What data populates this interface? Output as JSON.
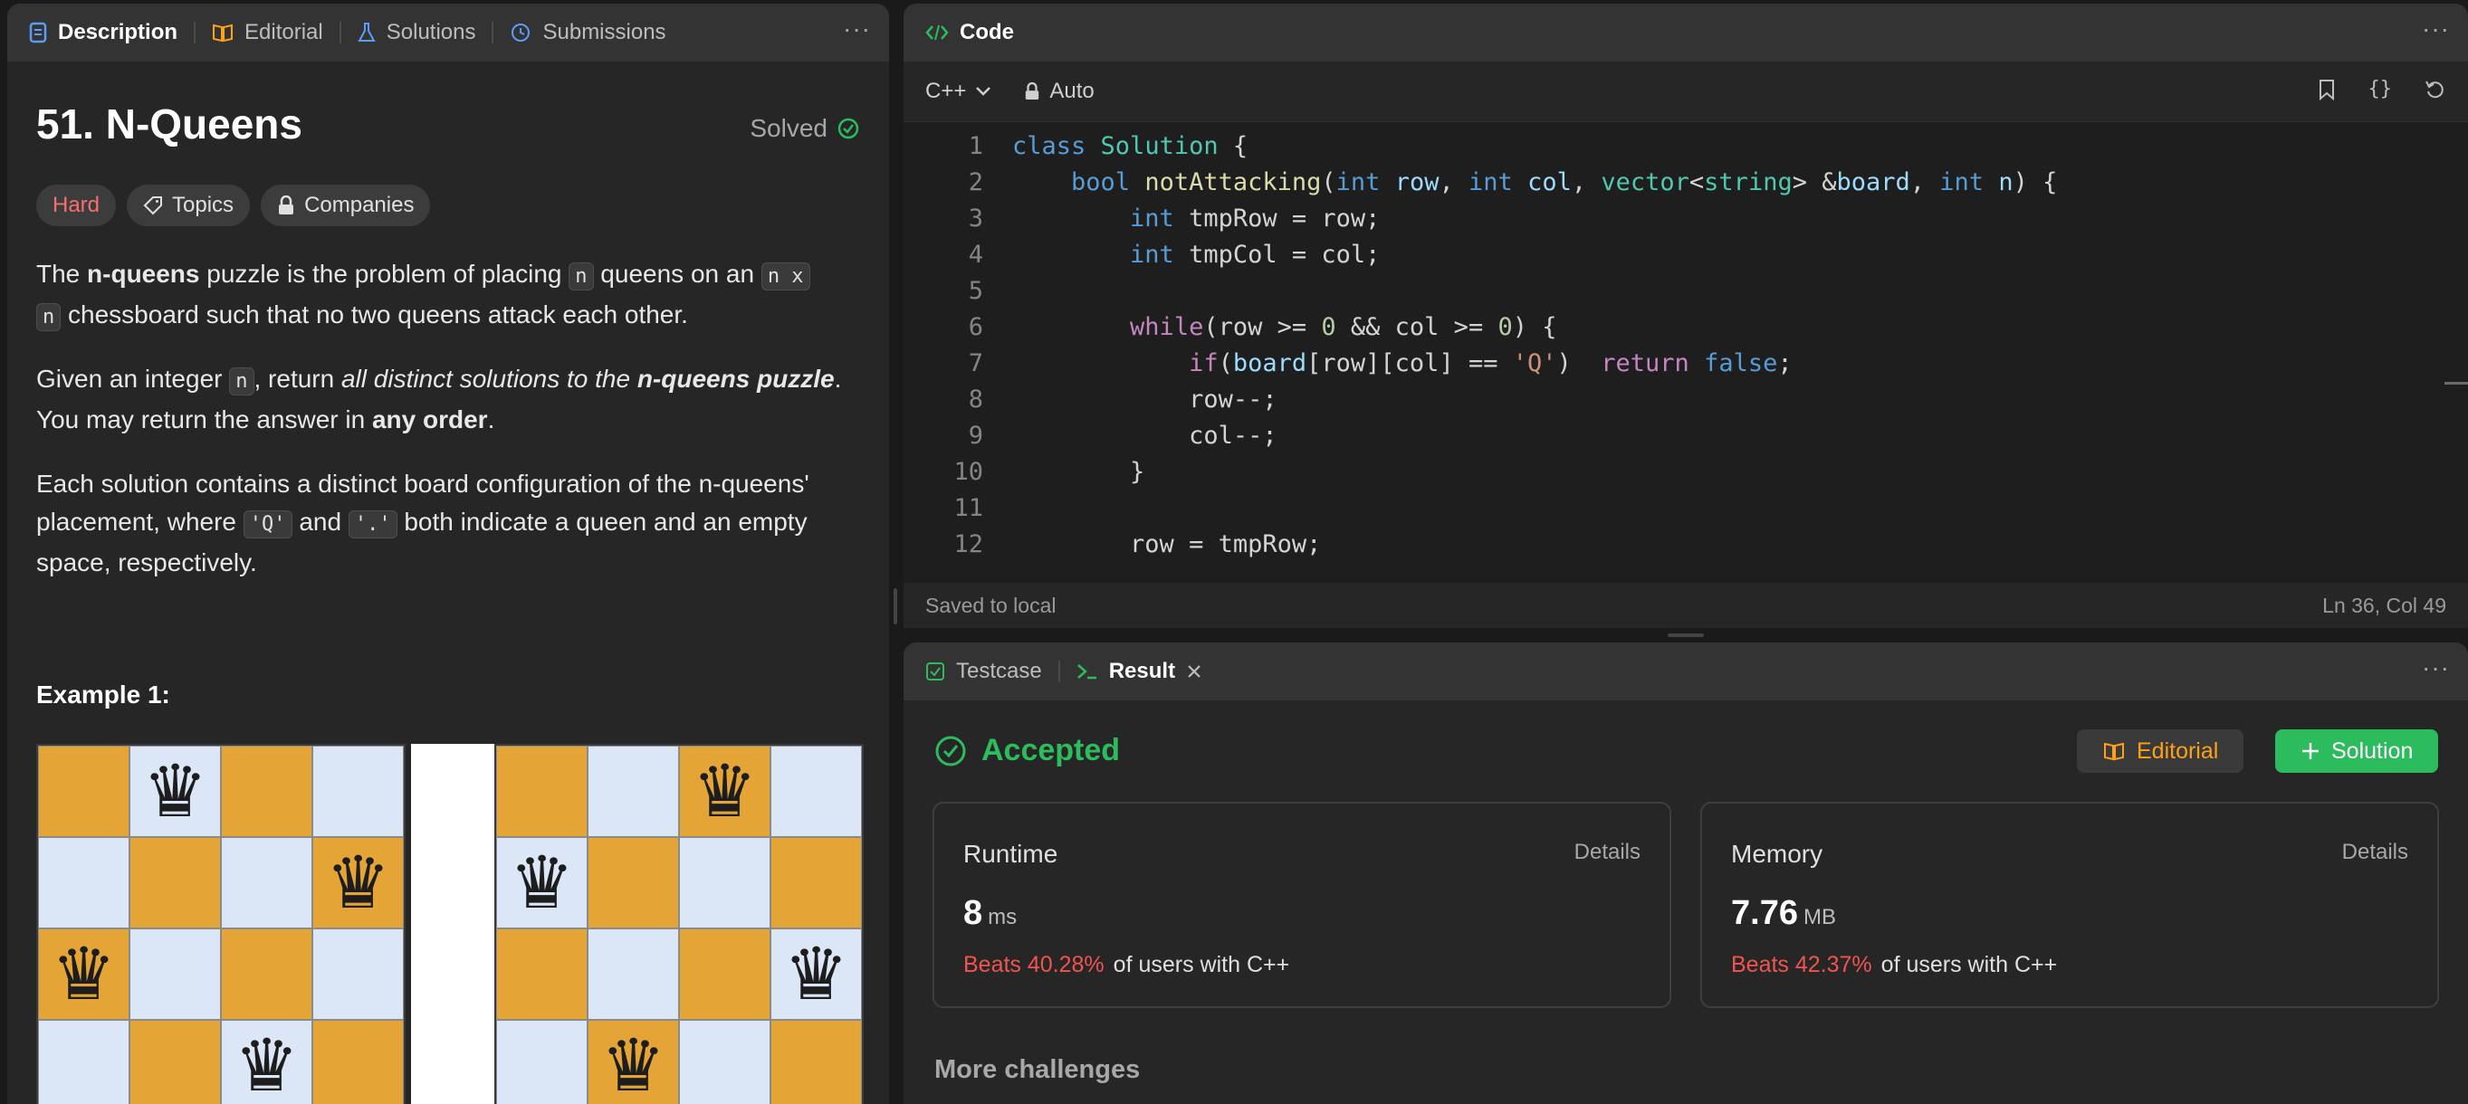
{
  "description_panel": {
    "tabs": [
      {
        "label": "Description",
        "icon": "document-icon",
        "active": true
      },
      {
        "label": "Editorial",
        "icon": "book-icon",
        "active": false
      },
      {
        "label": "Solutions",
        "icon": "flask-icon",
        "active": false
      },
      {
        "label": "Submissions",
        "icon": "history-icon",
        "active": false
      }
    ],
    "more": "···",
    "title": "51. N-Queens",
    "status": "Solved",
    "chips": {
      "difficulty": "Hard",
      "topics": "Topics",
      "companies": "Companies"
    },
    "p1": {
      "t1": "The ",
      "b1": "n-queens",
      "t2": " puzzle is the problem of placing ",
      "c1": "n",
      "t3": " queens on an ",
      "c2": "n x",
      "c3": "n",
      "t4": " chessboard such that no two queens attack each other."
    },
    "p2": {
      "t1": "Given an integer ",
      "c1": "n",
      "t2": ", return ",
      "i1": "all distinct solutions to the ",
      "ib1": "n-queens puzzle",
      "t3": ". You may return the answer in ",
      "b1": "any order",
      "t4": "."
    },
    "p3": {
      "t1": "Each solution contains a distinct board configuration of the n-queens' placement, where ",
      "c1": "'Q'",
      "t2": " and ",
      "c2": "'.'",
      "t3": " both indicate a queen and an empty space, respectively."
    },
    "example_title": "Example 1:",
    "queen_glyph": "♛",
    "boards": [
      {
        "queens": [
          [
            0,
            1
          ],
          [
            1,
            3
          ],
          [
            2,
            0
          ],
          [
            3,
            2
          ]
        ]
      },
      {
        "queens": [
          [
            0,
            2
          ],
          [
            1,
            0
          ],
          [
            2,
            3
          ],
          [
            3,
            1
          ]
        ]
      }
    ],
    "colors": {
      "light_square": "#dbe6f7",
      "dark_square": "#e4a536"
    }
  },
  "code_panel": {
    "title": "Code",
    "language": "C++",
    "mode": "Auto",
    "lines": [
      {
        "n": "1",
        "html": "<span class='kw'>class</span> <span class='ty'>Solution</span> {"
      },
      {
        "n": "2",
        "html": "    <span class='kw'>bool</span> <span class='fn'>notAttacking</span>(<span class='kw'>int</span> <span class='var'>row</span>, <span class='kw'>int</span> <span class='var'>col</span>, <span class='ty'>vector</span>&lt;<span class='ty'>string</span>&gt; &amp;<span class='var'>board</span>, <span class='kw'>int</span> <span class='var'>n</span>) {"
      },
      {
        "n": "3",
        "html": "        <span class='kw'>int</span> tmpRow = row;"
      },
      {
        "n": "4",
        "html": "        <span class='kw'>int</span> tmpCol = col;"
      },
      {
        "n": "5",
        "html": ""
      },
      {
        "n": "6",
        "html": "        <span class='kw2'>while</span>(row &gt;= <span class='num'>0</span> &amp;&amp; col &gt;= <span class='num'>0</span>) {"
      },
      {
        "n": "7",
        "html": "            <span class='kw2'>if</span>(<span class='var'>board</span>[row][col] == <span class='str'>'Q'</span>)  <span class='kw2'>return</span> <span class='kw'>false</span>;"
      },
      {
        "n": "8",
        "html": "            row--;"
      },
      {
        "n": "9",
        "html": "            col--;"
      },
      {
        "n": "10",
        "html": "        }"
      },
      {
        "n": "11",
        "html": ""
      },
      {
        "n": "12",
        "html": "        row = tmpRow;"
      }
    ],
    "status_left": "Saved to local",
    "status_right": "Ln 36, Col 49"
  },
  "result_panel": {
    "tabs": [
      {
        "label": "Testcase",
        "icon": "checkbox-icon",
        "active": false
      },
      {
        "label": "Result",
        "icon": "terminal-icon",
        "active": true
      }
    ],
    "verdict": "Accepted",
    "editorial_button": "Editorial",
    "solution_button": "Solution",
    "runtime": {
      "title": "Runtime",
      "details": "Details",
      "value": "8",
      "unit": "ms",
      "beats": "Beats 40.28%",
      "suffix": "of users with C++"
    },
    "memory": {
      "title": "Memory",
      "details": "Details",
      "value": "7.76",
      "unit": "MB",
      "beats": "Beats 42.37%",
      "suffix": "of users with C++"
    },
    "more_challenges": "More challenges"
  }
}
